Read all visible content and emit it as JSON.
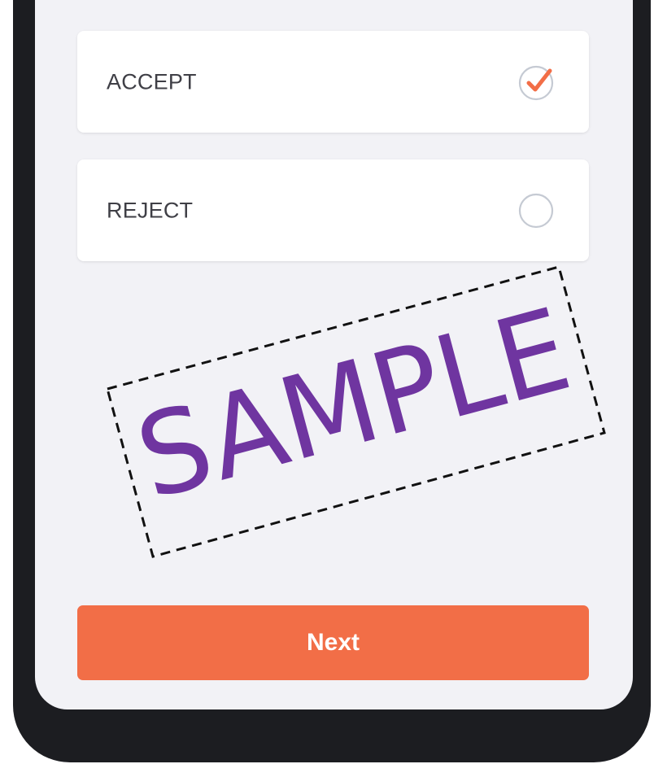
{
  "options": [
    {
      "label": "ACCEPT",
      "selected": true
    },
    {
      "label": "REJECT",
      "selected": false
    }
  ],
  "next_button": {
    "label": "Next"
  },
  "watermark": {
    "text": "SAMPLE"
  },
  "colors": {
    "accent": "#f26e47",
    "watermark": "#6f35a0",
    "screen_background": "#f2f2f6",
    "device_frame": "#1c1d21"
  }
}
